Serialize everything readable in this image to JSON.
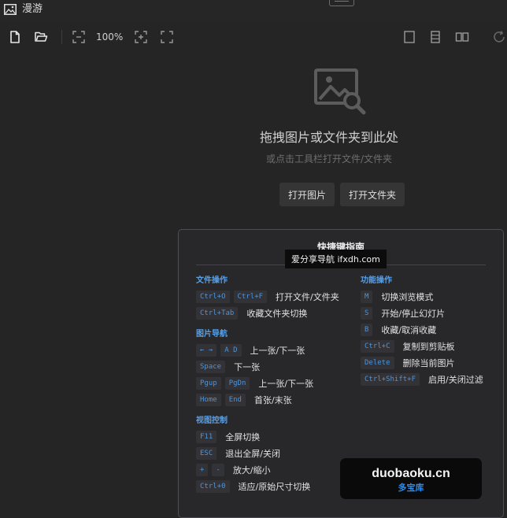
{
  "window": {
    "title": "漫游"
  },
  "toolbar": {
    "zoom": "100%"
  },
  "colors": {
    "accent": "#5aa0e6",
    "background": "#252525",
    "panel": "#28282b"
  },
  "empty_state": {
    "title": "拖拽图片或文件夹到此处",
    "subtitle": "或点击工具栏打开文件/文件夹",
    "open_image_label": "打开图片",
    "open_folder_label": "打开文件夹"
  },
  "guide": {
    "title": "快捷键指南",
    "sections_left": [
      {
        "title": "文件操作",
        "rows": [
          {
            "keys": [
              "Ctrl+O",
              "Ctrl+F"
            ],
            "desc": "打开文件/文件夹"
          },
          {
            "keys": [
              "Ctrl+Tab"
            ],
            "desc": "收藏文件夹切换"
          }
        ]
      },
      {
        "title": "图片导航",
        "rows": [
          {
            "keys": [
              "← →",
              "A D"
            ],
            "desc": "上一张/下一张"
          },
          {
            "keys": [
              "Space"
            ],
            "desc": "下一张"
          },
          {
            "keys": [
              "Pgup",
              "PgDn"
            ],
            "desc": "上一张/下一张"
          },
          {
            "keys": [
              "Home",
              "End"
            ],
            "desc": "首张/末张"
          }
        ]
      },
      {
        "title": "视图控制",
        "rows": [
          {
            "keys": [
              "F11"
            ],
            "desc": "全屏切换"
          },
          {
            "keys": [
              "ESC"
            ],
            "desc": "退出全屏/关闭"
          },
          {
            "keys": [
              "+",
              "-"
            ],
            "desc": "放大/缩小"
          },
          {
            "keys": [
              "Ctrl+0"
            ],
            "desc": "适应/原始尺寸切换"
          }
        ]
      }
    ],
    "sections_right": [
      {
        "title": "功能操作",
        "rows": [
          {
            "keys": [
              "M"
            ],
            "desc": "切换浏览模式"
          },
          {
            "keys": [
              "S"
            ],
            "desc": "开始/停止幻灯片"
          },
          {
            "keys": [
              "B"
            ],
            "desc": "收藏/取消收藏"
          },
          {
            "keys": [
              "Ctrl+C"
            ],
            "desc": "复制到剪贴板"
          },
          {
            "keys": [
              "Delete"
            ],
            "desc": "删除当前图片"
          },
          {
            "keys": [
              "Ctrl+Shift+F"
            ],
            "desc": "启用/关闭过滤"
          }
        ]
      }
    ]
  },
  "watermarks": {
    "badge": "爱分享导航 ifxdh.com",
    "domain": "duobaoku.cn",
    "name": "多宝库"
  }
}
